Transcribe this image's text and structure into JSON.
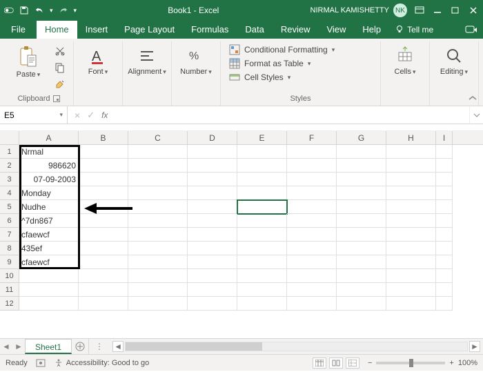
{
  "titlebar": {
    "doc_title": "Book1 - Excel",
    "user_name": "NIRMAL KAMISHETTY",
    "user_initials": "NK"
  },
  "tabs": {
    "file": "File",
    "home": "Home",
    "insert": "Insert",
    "page_layout": "Page Layout",
    "formulas": "Formulas",
    "data": "Data",
    "review": "Review",
    "view": "View",
    "help": "Help",
    "tell_me": "Tell me"
  },
  "ribbon": {
    "clipboard": {
      "label": "Clipboard",
      "paste": "Paste"
    },
    "font": {
      "label": "Font"
    },
    "alignment": {
      "label": "Alignment"
    },
    "number": {
      "label": "Number"
    },
    "styles": {
      "label": "Styles",
      "cond_fmt": "Conditional Formatting",
      "fmt_table": "Format as Table",
      "cell_styles": "Cell Styles"
    },
    "cells": {
      "label": "Cells"
    },
    "editing": {
      "label": "Editing"
    }
  },
  "namebox": {
    "value": "E5"
  },
  "formula": {
    "value": ""
  },
  "columns": [
    "A",
    "B",
    "C",
    "D",
    "E",
    "F",
    "G",
    "H",
    "I"
  ],
  "cells": {
    "A1": "Nrmal",
    "A2": "986620",
    "A3": "07-09-2003",
    "A4": "Monday",
    "A5": "Nudhe",
    "A6": "^7dn867",
    "A7": "cfaewcf",
    "A8": "435ef",
    "A9": "cfaewcf"
  },
  "sheets": {
    "active": "Sheet1"
  },
  "status": {
    "ready": "Ready",
    "accessibility": "Accessibility: Good to go",
    "zoom": "100%"
  }
}
